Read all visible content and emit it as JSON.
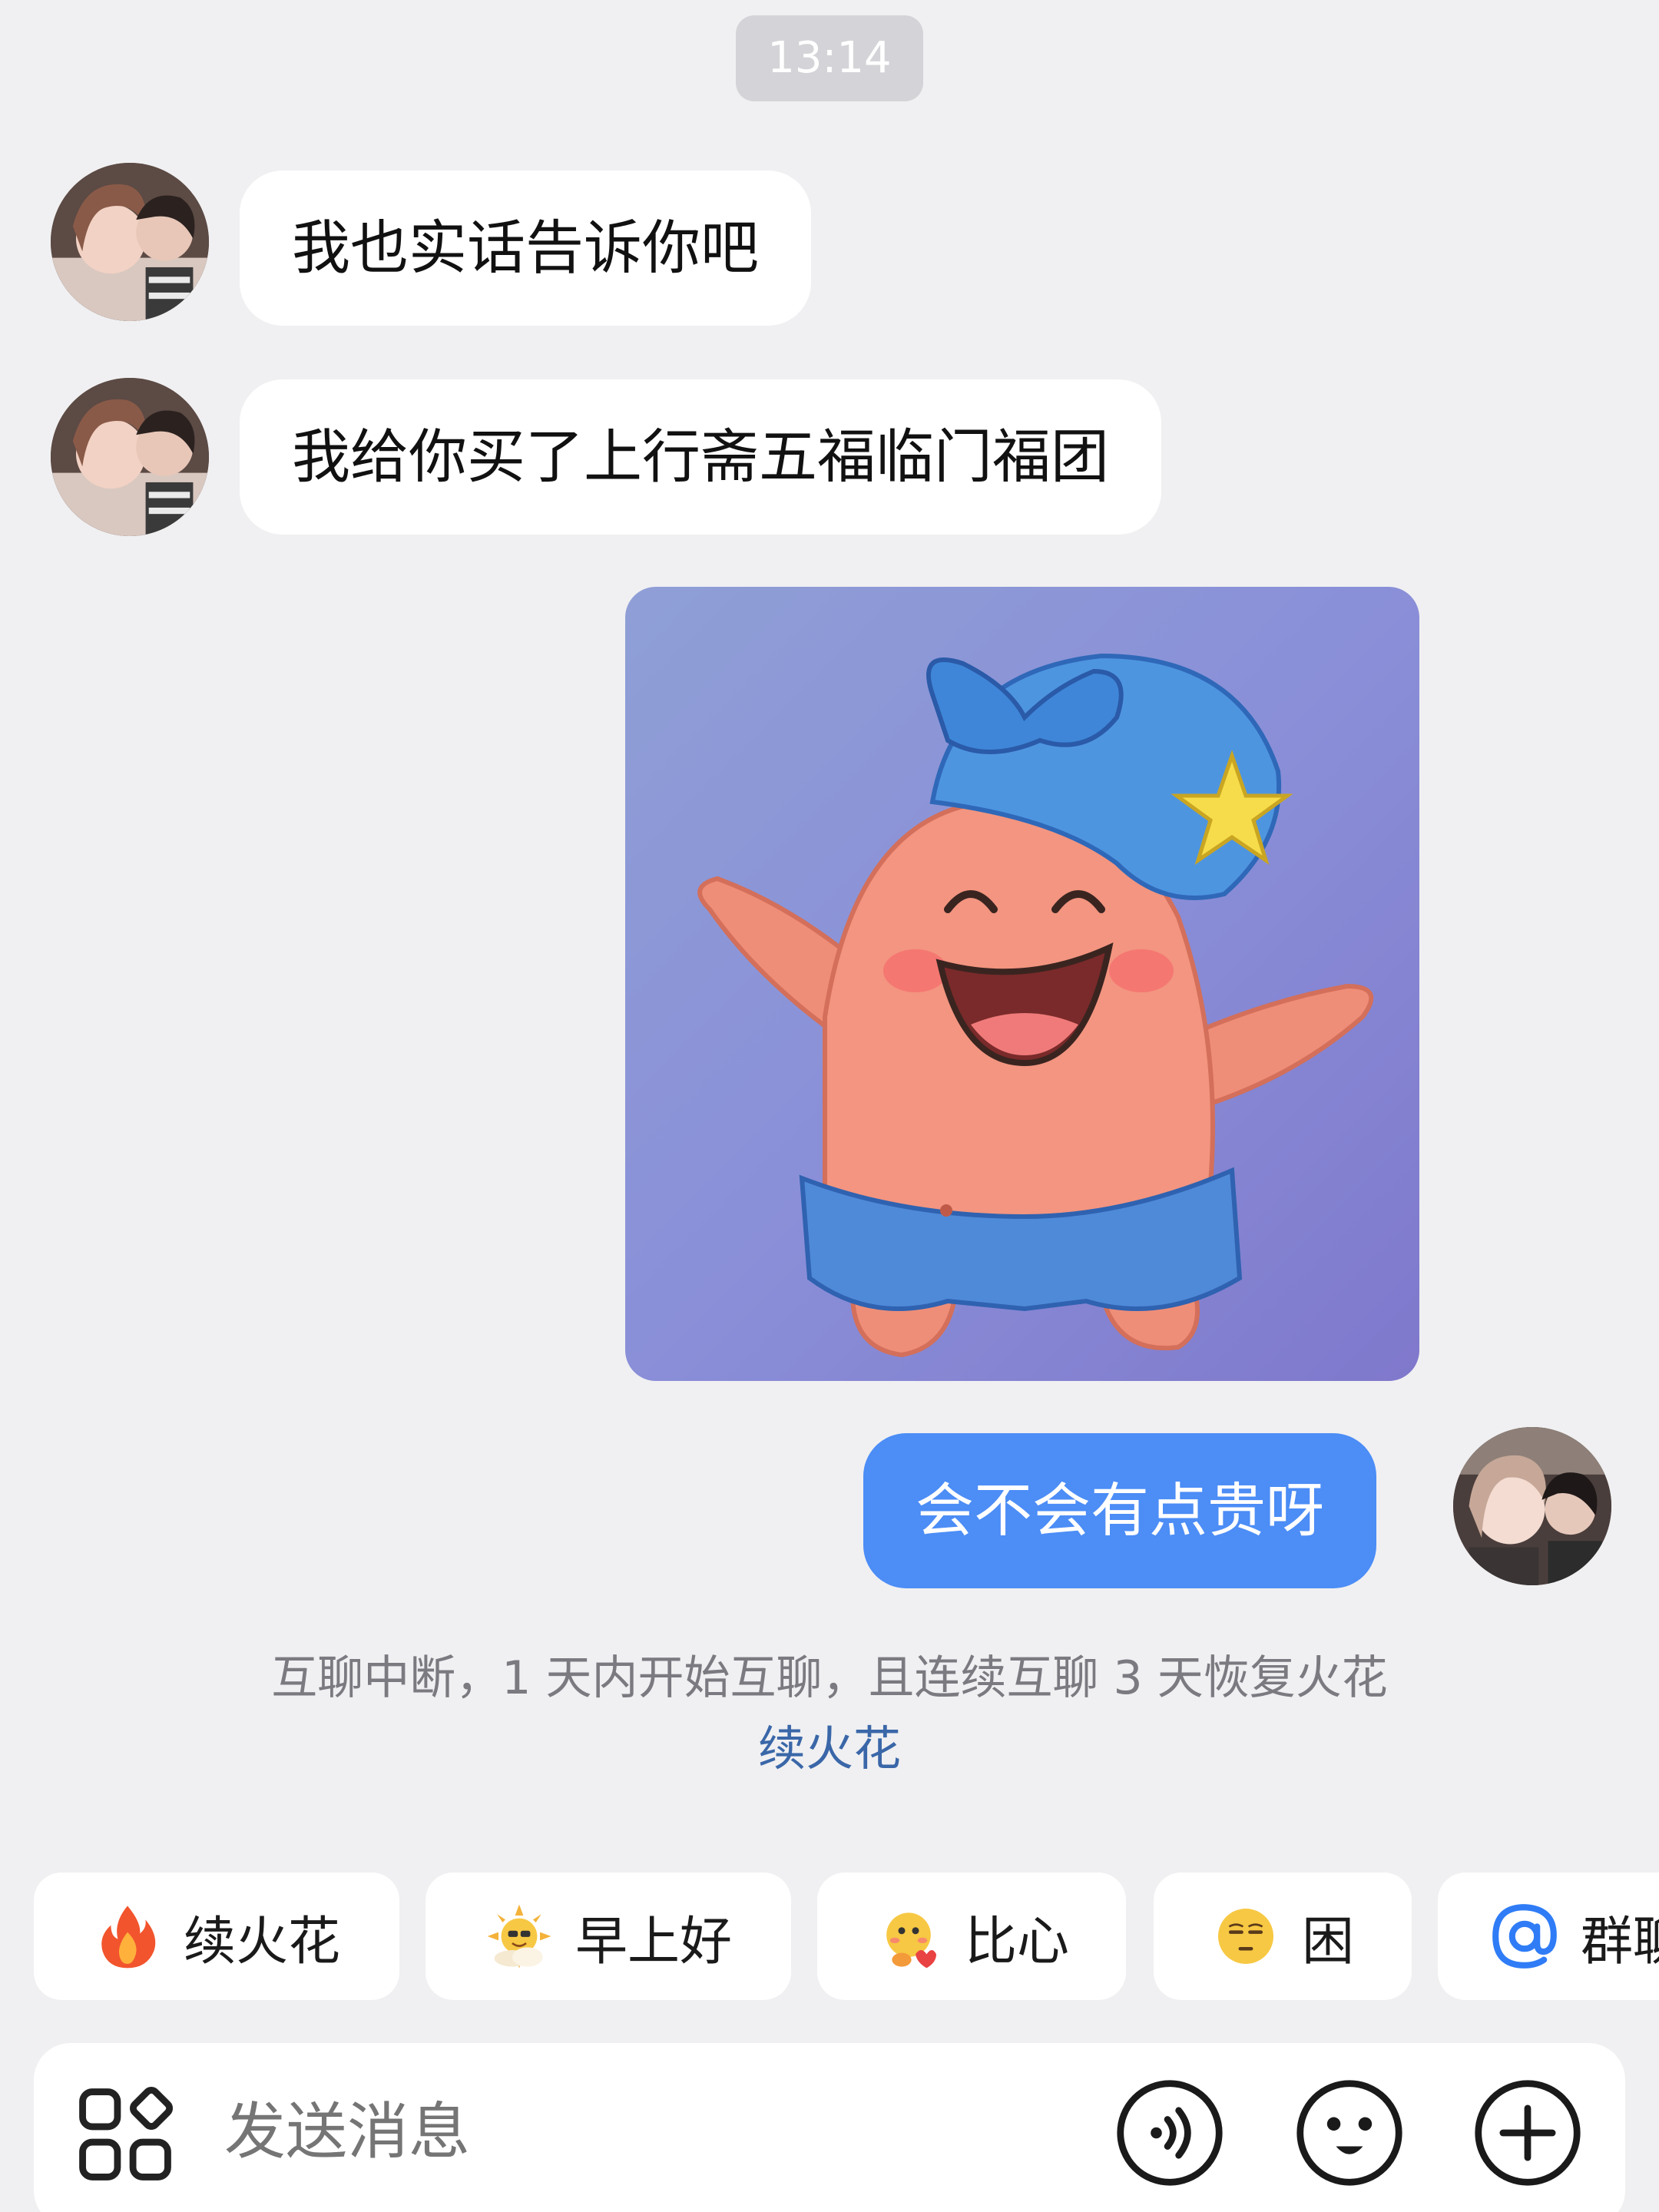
{
  "time": "13:14",
  "messages": [
    {
      "sender": "other",
      "text": "我也实话告诉你吧"
    },
    {
      "sender": "other",
      "text": "我给你买了上行斋五福临门福团"
    },
    {
      "sender": "self",
      "type": "sticker",
      "sticker": "smiling-pink-starfish-blue-hat"
    },
    {
      "sender": "self",
      "text": "会不会有点贵呀"
    }
  ],
  "system_notice": {
    "text": "互聊中断，1 天内开始互聊，且连续互聊 3 天恢复火花",
    "link": "续火花"
  },
  "quick_replies": [
    {
      "label": "续火花",
      "icon": "fire-icon"
    },
    {
      "label": "早上好",
      "icon": "sun-cloud-emoji-icon"
    },
    {
      "label": "比心",
      "icon": "heart-hands-emoji-icon"
    },
    {
      "label": "困",
      "icon": "sleepy-face-icon"
    },
    {
      "label": "群聊",
      "icon": "at-icon"
    }
  ],
  "input": {
    "placeholder": "发送消息"
  },
  "colors": {
    "background": "#f0f0f2",
    "self_bubble": "#4c8df6",
    "link": "#3a67a8",
    "at_icon": "#2f7cf6"
  }
}
